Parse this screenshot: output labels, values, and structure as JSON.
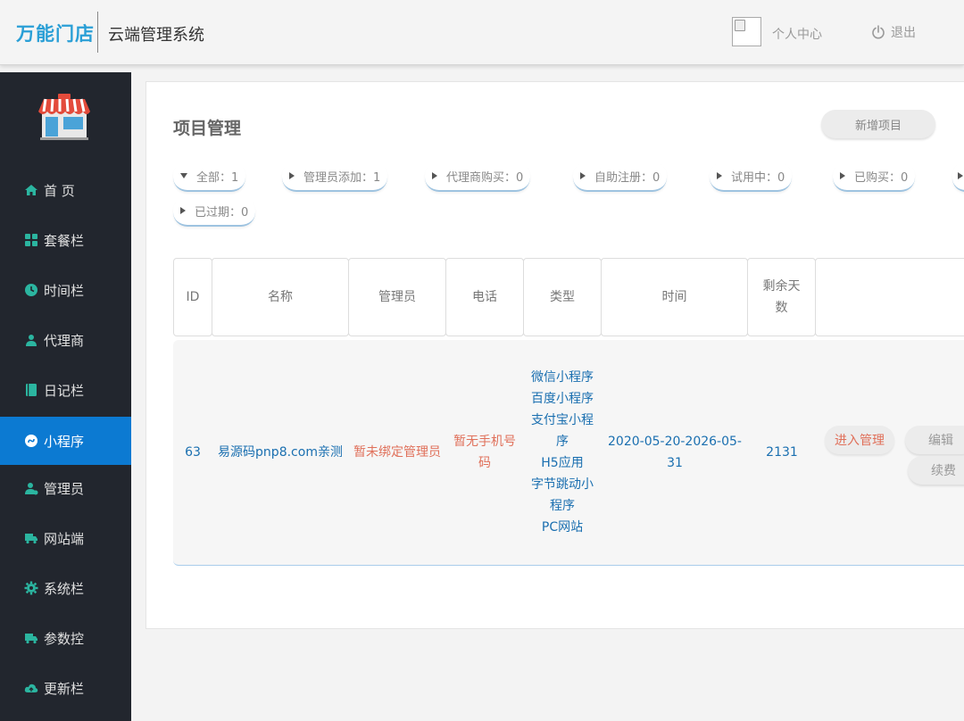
{
  "header": {
    "logo": "万能门店",
    "system_title": "云端管理系统",
    "profile_label": "个人中心",
    "logout_label": "退出",
    "logo_color": "#2a9fd6"
  },
  "sidebar": {
    "items": [
      {
        "label": "首 页",
        "icon": "home-icon"
      },
      {
        "label": "套餐栏",
        "icon": "grid-icon"
      },
      {
        "label": "时间栏",
        "icon": "clock-icon"
      },
      {
        "label": "代理商",
        "icon": "user-icon"
      },
      {
        "label": "日记栏",
        "icon": "book-icon"
      },
      {
        "label": "小程序",
        "icon": "miniprogram-icon",
        "active": true
      },
      {
        "label": "管理员",
        "icon": "admin-icon"
      },
      {
        "label": "网站端",
        "icon": "truck-icon"
      },
      {
        "label": "系统栏",
        "icon": "gear-icon"
      },
      {
        "label": "参数控",
        "icon": "truck-icon"
      },
      {
        "label": "更新栏",
        "icon": "cloud-icon"
      }
    ],
    "active_color": "#0c7ad2",
    "icon_color": "#2bb5a0"
  },
  "main": {
    "title": "项目管理",
    "add_button": "新增项目",
    "filters": [
      {
        "label": "全部：1",
        "expanded": true
      },
      {
        "label": "管理员添加：1"
      },
      {
        "label": "代理商购买：0"
      },
      {
        "label": "自助注册：0"
      },
      {
        "label": "试用中：0"
      },
      {
        "label": "已购买：0"
      },
      {
        "label": "已过期：0"
      }
    ],
    "table": {
      "headers": [
        "ID",
        "名称",
        "管理员",
        "电话",
        "类型",
        "时间",
        "剩余天数",
        ""
      ],
      "rows": [
        {
          "id": "63",
          "name": "易源码pnp8.com亲测",
          "admin": "暂未绑定管理员",
          "phone": "暂无手机号码",
          "types": [
            "微信小程序",
            "百度小程序",
            "支付宝小程序",
            "H5应用",
            "字节跳动小程序",
            "PC网站"
          ],
          "time": "2020-05-20-2026-05-31",
          "days_left": "2131",
          "actions": {
            "manage": "进入管理",
            "edit": "编辑",
            "renew": "续费"
          }
        }
      ]
    }
  }
}
